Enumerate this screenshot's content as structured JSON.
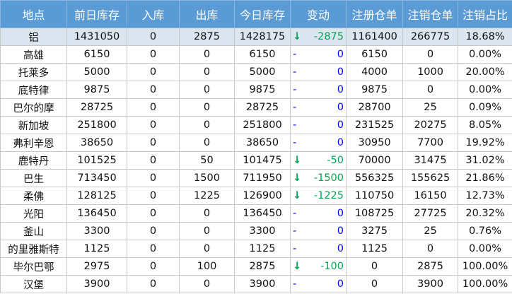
{
  "table": {
    "headers": [
      "地点",
      "前日库存",
      "入库",
      "出库",
      "今日库存",
      "变动",
      "注册仓单",
      "注销仓单",
      "注销占比"
    ],
    "rows": [
      {
        "loc": "铝",
        "prev": "1431050",
        "in": "0",
        "out": "2875",
        "today": "1428175",
        "arrow": "↓",
        "change": "-2875",
        "reg": "1161400",
        "cancel": "266775",
        "ratio": "18.68%",
        "trend": "down",
        "highlight": true
      },
      {
        "loc": "高雄",
        "prev": "6150",
        "in": "0",
        "out": "0",
        "today": "6150",
        "arrow": "-",
        "change": "0",
        "reg": "6150",
        "cancel": "0",
        "ratio": "0.00%",
        "trend": "flat"
      },
      {
        "loc": "托莱多",
        "prev": "5000",
        "in": "0",
        "out": "0",
        "today": "5000",
        "arrow": "-",
        "change": "0",
        "reg": "4000",
        "cancel": "1000",
        "ratio": "20.00%",
        "trend": "flat"
      },
      {
        "loc": "底特律",
        "prev": "9875",
        "in": "0",
        "out": "0",
        "today": "9875",
        "arrow": "-",
        "change": "0",
        "reg": "9875",
        "cancel": "0",
        "ratio": "0.00%",
        "trend": "flat"
      },
      {
        "loc": "巴尔的摩",
        "prev": "28725",
        "in": "0",
        "out": "0",
        "today": "28725",
        "arrow": "-",
        "change": "0",
        "reg": "28700",
        "cancel": "25",
        "ratio": "0.09%",
        "trend": "flat"
      },
      {
        "loc": "新加坡",
        "prev": "251800",
        "in": "0",
        "out": "0",
        "today": "251800",
        "arrow": "-",
        "change": "0",
        "reg": "231525",
        "cancel": "20275",
        "ratio": "8.05%",
        "trend": "flat"
      },
      {
        "loc": "弗利辛恩",
        "prev": "38650",
        "in": "0",
        "out": "0",
        "today": "38650",
        "arrow": "-",
        "change": "0",
        "reg": "30950",
        "cancel": "7700",
        "ratio": "19.92%",
        "trend": "flat"
      },
      {
        "loc": "鹿特丹",
        "prev": "101525",
        "in": "0",
        "out": "50",
        "today": "101475",
        "arrow": "↓",
        "change": "-50",
        "reg": "70000",
        "cancel": "31475",
        "ratio": "31.02%",
        "trend": "down"
      },
      {
        "loc": "巴生",
        "prev": "713450",
        "in": "0",
        "out": "1500",
        "today": "711950",
        "arrow": "↓",
        "change": "-1500",
        "reg": "556325",
        "cancel": "155625",
        "ratio": "21.86%",
        "trend": "down"
      },
      {
        "loc": "柔佛",
        "prev": "128125",
        "in": "0",
        "out": "1225",
        "today": "126900",
        "arrow": "↓",
        "change": "-1225",
        "reg": "110750",
        "cancel": "16150",
        "ratio": "12.73%",
        "trend": "down"
      },
      {
        "loc": "光阳",
        "prev": "136450",
        "in": "0",
        "out": "0",
        "today": "136450",
        "arrow": "-",
        "change": "0",
        "reg": "108725",
        "cancel": "27725",
        "ratio": "20.32%",
        "trend": "flat"
      },
      {
        "loc": "釜山",
        "prev": "3300",
        "in": "0",
        "out": "0",
        "today": "3300",
        "arrow": "-",
        "change": "0",
        "reg": "3275",
        "cancel": "25",
        "ratio": "0.76%",
        "trend": "flat"
      },
      {
        "loc": "的里雅斯特",
        "prev": "1125",
        "in": "0",
        "out": "0",
        "today": "1125",
        "arrow": "-",
        "change": "0",
        "reg": "1125",
        "cancel": "0",
        "ratio": "0.00%",
        "trend": "flat"
      },
      {
        "loc": "毕尔巴鄂",
        "prev": "2975",
        "in": "0",
        "out": "100",
        "today": "2875",
        "arrow": "↓",
        "change": "-100",
        "reg": "0",
        "cancel": "2875",
        "ratio": "100.00%",
        "trend": "down"
      },
      {
        "loc": "汉堡",
        "prev": "3900",
        "in": "0",
        "out": "0",
        "today": "3900",
        "arrow": "-",
        "change": "0",
        "reg": "0",
        "cancel": "3900",
        "ratio": "100.00%",
        "trend": "flat"
      }
    ]
  }
}
